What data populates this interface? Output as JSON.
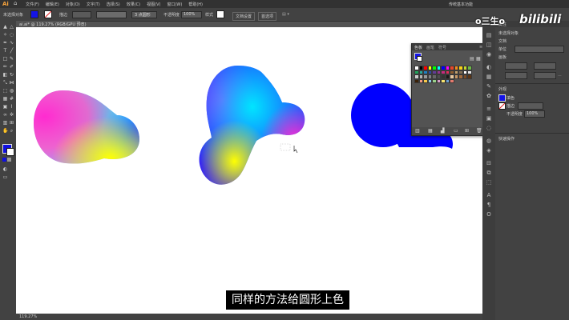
{
  "app": {
    "logo": "Ai",
    "workspace": "传统基本功能"
  },
  "menubar": {
    "items": [
      "文件(F)",
      "编辑(E)",
      "对象(O)",
      "文字(T)",
      "选择(S)",
      "效果(C)",
      "视图(V)",
      "窗口(W)",
      "帮助(H)"
    ]
  },
  "control": {
    "no_selection": "未选择对象",
    "stroke_label": "描边",
    "stroke_value": "",
    "brush": "3 点圆形",
    "opacity_label": "不透明度",
    "opacity_value": "100%",
    "style_label": "样式",
    "doc_setup": "文档设置",
    "prefs": "首选项",
    "fill_color": "#1414e6",
    "stroke_color": "#ffffff"
  },
  "document": {
    "tab": "ai.ai* @ 119.27% (RGB/GPU 预览)"
  },
  "status": {
    "zoom": "119.27%"
  },
  "swatches_panel": {
    "tabs": [
      "色板",
      "画笔",
      "符号"
    ],
    "colors": [
      "#ffffff",
      "#000000",
      "#ff0000",
      "#ffff00",
      "#00ff00",
      "#00ffff",
      "#0000ff",
      "#ff00ff",
      "#e8462a",
      "#f28d1f",
      "#f7d117",
      "#c4d82d",
      "#6bb846",
      "#1ea259",
      "#25a99c",
      "#1f7fc2",
      "#2f4aa0",
      "#633b97",
      "#95338f",
      "#c8297e",
      "#e2295a",
      "#8a5b2e",
      "#c2a16b",
      "#7d6b52",
      "#ffffff",
      "#e6e6e6",
      "#cccccc",
      "#b3b3b3",
      "#999999",
      "#808080",
      "#666666",
      "#4d4d4d",
      "#333333",
      "#1a1a1a",
      "#e8c9a0",
      "#c79a66",
      "#a26b3d",
      "#7a4b24",
      "#5c3514",
      "#3b2108",
      "#f39a86",
      "#f7c94b",
      "#89c7e8",
      "#9ad18b",
      "#d89ec9",
      "#f6e36e",
      "#6a9fd4",
      "#e47a6e"
    ]
  },
  "properties_panel": {
    "title": "属性",
    "section_no_selection": "未选择对象",
    "section_document": "文档",
    "units_label": "单位",
    "artboard_label": "画板",
    "appearance_title": "外观",
    "fill_label": "填色",
    "stroke_label": "描边",
    "opacity_label": "不透明度",
    "opacity_value": "100%",
    "quick_actions": "快速操作"
  },
  "toolbar": {
    "tools": [
      "selection",
      "direct-selection",
      "magic-wand",
      "lasso",
      "pen",
      "curvature",
      "type",
      "line",
      "rectangle",
      "paintbrush",
      "pencil",
      "shaper",
      "eraser",
      "rotate",
      "scale",
      "width",
      "free-transform",
      "shape-builder",
      "perspective",
      "mesh",
      "gradient",
      "eyedropper",
      "blend",
      "symbol-sprayer",
      "column-graph",
      "artboard",
      "slice",
      "hand",
      "zoom"
    ],
    "fill_color": "#1010e0",
    "stroke_color": "#ffffff"
  },
  "canvas_shapes": {
    "left_blob": "gradient-blob-pink-cyan-yellow",
    "middle_blob": "gradient-blob-blue-cyan-magenta-yellow",
    "right_blob": "solid-blue-blob",
    "right_blob_color": "#0000ff"
  },
  "watermark": {
    "user": "o三生o",
    "site": "bilibili"
  },
  "subtitle": {
    "text": "同样的方法给圆形上色"
  }
}
